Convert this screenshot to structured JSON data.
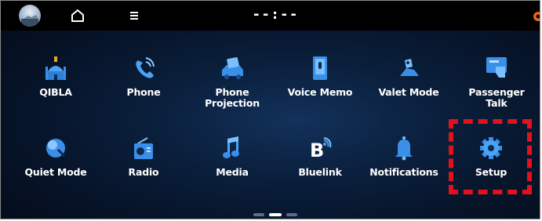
{
  "status_bar": {
    "clock": "--:--",
    "icons": [
      "avatar",
      "home-icon",
      "menu-icon",
      "status-icon"
    ]
  },
  "apps": [
    {
      "label": "QIBLA",
      "icon": "mosque-icon"
    },
    {
      "label": "Phone",
      "icon": "phone-icon"
    },
    {
      "label": "Phone\nProjection",
      "icon": "phone-projection-icon"
    },
    {
      "label": "Voice Memo",
      "icon": "voice-memo-icon"
    },
    {
      "label": "Valet Mode",
      "icon": "valet-mode-icon"
    },
    {
      "label": "Passenger\nTalk",
      "icon": "passenger-talk-icon"
    },
    {
      "label": "Quiet Mode",
      "icon": "quiet-mode-icon"
    },
    {
      "label": "Radio",
      "icon": "radio-icon"
    },
    {
      "label": "Media",
      "icon": "music-note-icon"
    },
    {
      "label": "Bluelink",
      "icon": "bluelink-icon"
    },
    {
      "label": "Notifications",
      "icon": "bell-icon"
    },
    {
      "label": "Setup",
      "icon": "gear-icon"
    }
  ],
  "pagination": {
    "pages": 3,
    "current": 2
  },
  "colors": {
    "icon_blue": "#3a8fe8",
    "highlight_red": "#e1121b",
    "background": "#0a1f3c"
  }
}
